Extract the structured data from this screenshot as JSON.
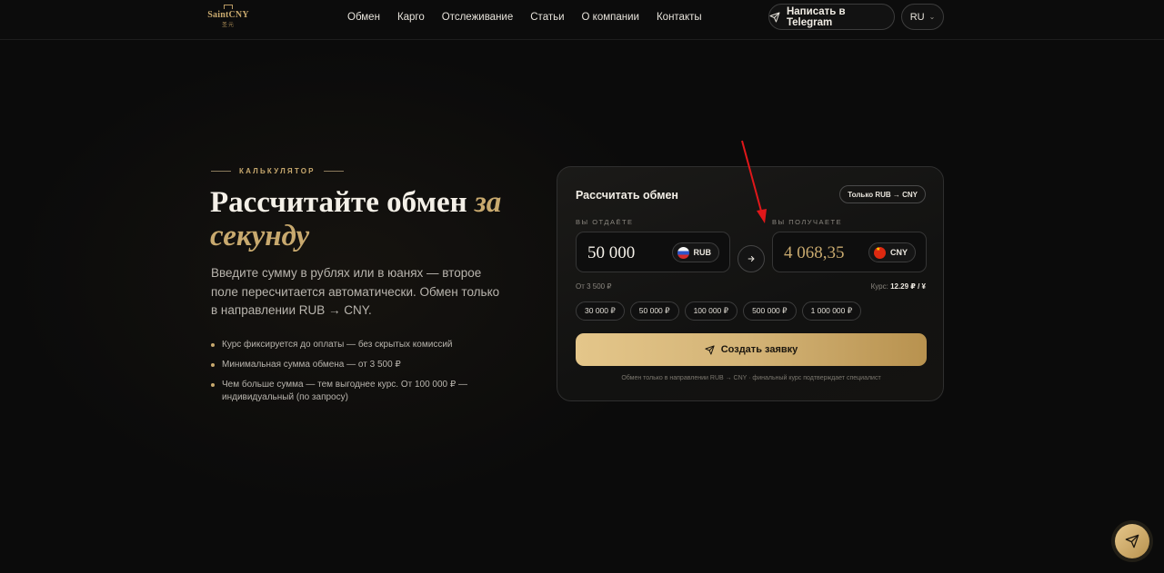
{
  "header": {
    "logo_text": "SaintCNY",
    "logo_sub": "圣元",
    "nav": [
      "Обмен",
      "Карго",
      "Отслеживание",
      "Статьи",
      "О компании",
      "Контакты"
    ],
    "telegram_label": "Написать в Telegram",
    "lang": "RU"
  },
  "hero": {
    "eyebrow": "КАЛЬКУЛЯТОР",
    "headline_plain": "Рассчитайте обмен ",
    "headline_accent": "за секунду",
    "lead": "Введите сумму в рублях или в юанях — второе поле пересчитается автоматически. Обмен только в направлении RUB → CNY.",
    "bullets": [
      "Курс фиксируется до оплаты — без скрытых комиссий",
      "Минимальная сумма обмена — от 3 500 ₽",
      "Чем больше сумма — тем выгоднее курс. От 100 000 ₽ — индивидуальный (по запросу)"
    ]
  },
  "calculator": {
    "title": "Рассчитать обмен",
    "badge": "Только RUB → CNY",
    "give_label": "ВЫ ОТДАЁТЕ",
    "give_value": "50 000",
    "give_currency": "RUB",
    "get_label": "ВЫ ПОЛУЧАЕТЕ",
    "get_value": "4 068,35",
    "get_currency": "CNY",
    "min_note": "От 3 500 ₽",
    "rate_label": "Курс:",
    "rate_value": "12.29 ₽ / ¥",
    "presets": [
      "30 000 ₽",
      "50 000 ₽",
      "100 000 ₽",
      "500 000 ₽",
      "1 000 000 ₽"
    ],
    "cta": "Создать заявку",
    "footnote": "Обмен только в направлении RUB → CNY · финальный курс подтверждает специалист"
  },
  "colors": {
    "accent_gold": "#c8a96e",
    "background": "#0b0b0b",
    "annotation_arrow": "#e0171a"
  }
}
